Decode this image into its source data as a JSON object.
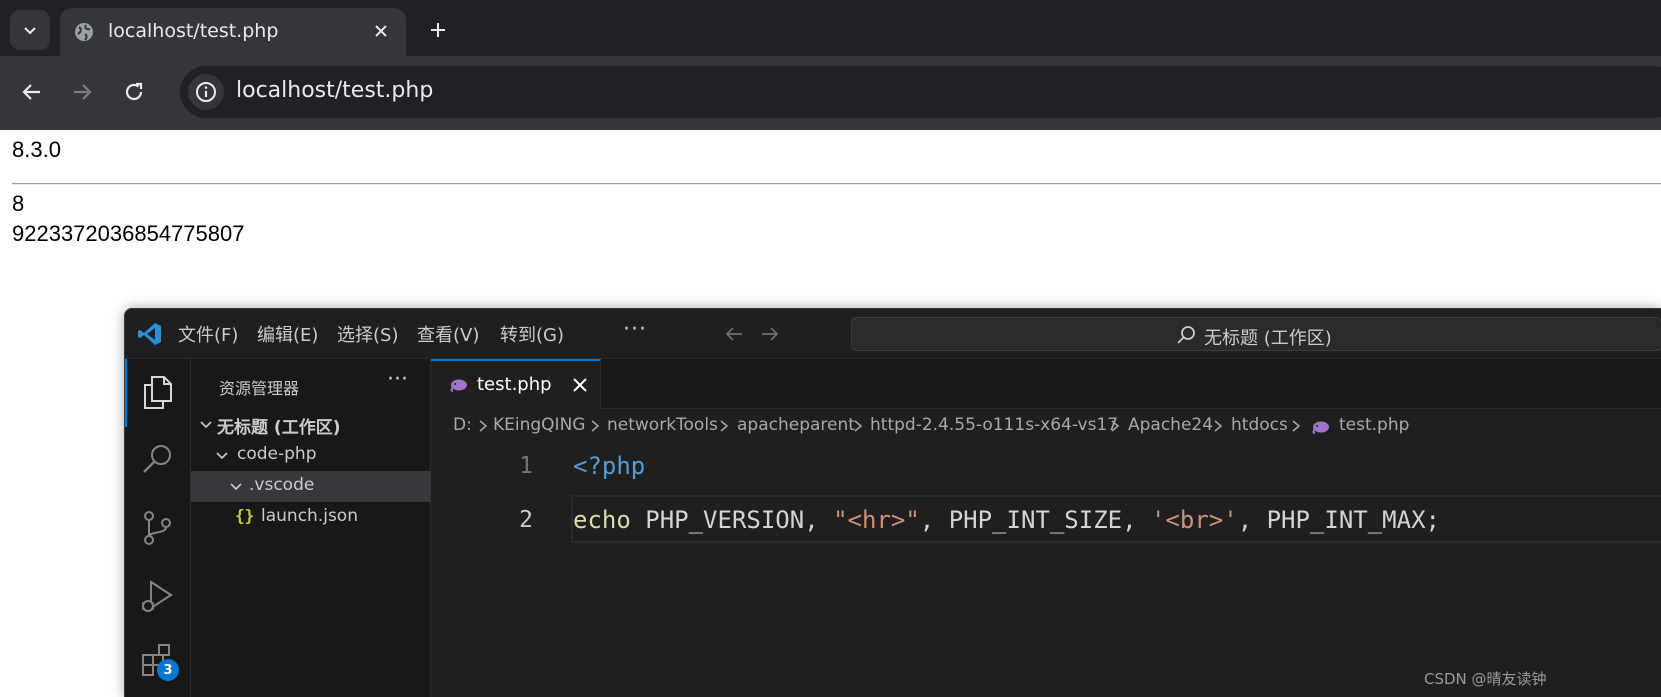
{
  "browser": {
    "tab_title": "localhost/test.php",
    "url": "localhost/test.php",
    "icons": {
      "tab_dropdown": "chevron-down-icon",
      "favicon": "globe-icon",
      "tab_close": "close-icon",
      "new_tab": "plus-icon",
      "back": "arrow-left-icon",
      "forward": "arrow-right-icon",
      "reload": "reload-icon",
      "site_info": "info-icon"
    }
  },
  "page_output": {
    "version": "8.3.0",
    "int_size": "8",
    "int_max": "9223372036854775807"
  },
  "vscode": {
    "menu": [
      "文件(F)",
      "编辑(E)",
      "选择(S)",
      "查看(V)",
      "转到(G)"
    ],
    "menu_more": "···",
    "command_center": "无标题 (工作区)",
    "explorer": {
      "title": "资源管理器",
      "more": "···",
      "tree": [
        {
          "label": "无标题 (工作区)",
          "bold": true
        },
        {
          "label": "code-php"
        },
        {
          "label": ".vscode"
        },
        {
          "label": "launch.json",
          "icon": "{}"
        }
      ]
    },
    "activity_badge": "3",
    "editor_tab": "test.php",
    "breadcrumbs": [
      "D:",
      "KEingQING",
      "networkTools",
      "apacheparent",
      "httpd-2.4.55-o111s-x64-vs17",
      "Apache24",
      "htdocs",
      "test.php"
    ],
    "code": {
      "line_numbers": [
        "1",
        "2"
      ],
      "line1": "<?php",
      "line2_tokens": [
        {
          "text": "echo",
          "color": "#dcdcaa"
        },
        {
          "text": " PHP_VERSION, ",
          "color": "#d4d4d4"
        },
        {
          "text": "\"<hr>\"",
          "color": "#ce9178"
        },
        {
          "text": ", PHP_INT_SIZE, ",
          "color": "#d4d4d4"
        },
        {
          "text": "'<br>'",
          "color": "#ce9178"
        },
        {
          "text": ", PHP_INT_MAX;",
          "color": "#d4d4d4"
        }
      ]
    },
    "colors": {
      "accent": "#0078d4",
      "php_tag": "#569cd6",
      "string": "#ce9178",
      "keyword": "#dcdcaa"
    }
  },
  "watermark": "CSDN @晴友读钟"
}
